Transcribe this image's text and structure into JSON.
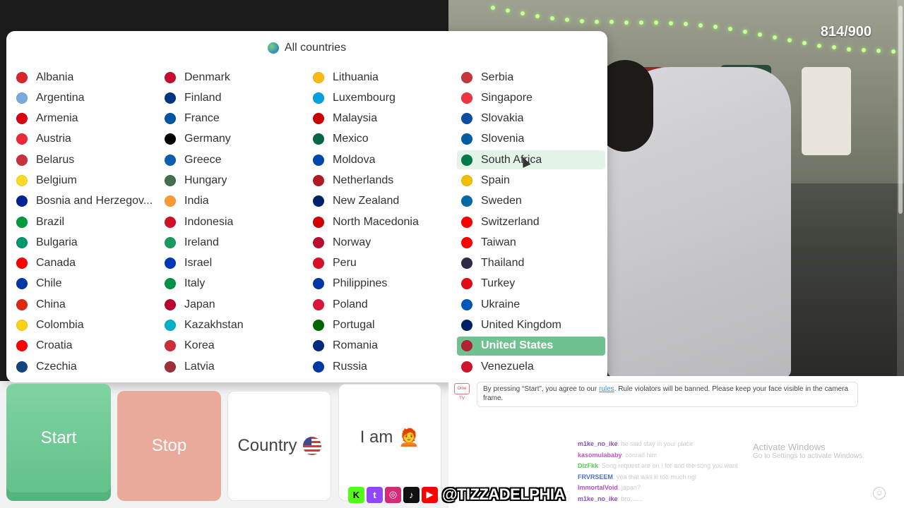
{
  "counter": "814/900",
  "popup": {
    "title": "All countries",
    "countries": [
      {
        "name": "Albania",
        "flag": "#d9252b"
      },
      {
        "name": "Argentina",
        "flag": "#74acdf"
      },
      {
        "name": "Armenia",
        "flag": "#d90012"
      },
      {
        "name": "Austria",
        "flag": "#ed2939"
      },
      {
        "name": "Belarus",
        "flag": "#c8313e"
      },
      {
        "name": "Belgium",
        "flag": "#fdda24"
      },
      {
        "name": "Bosnia and Herzegov...",
        "flag": "#002395"
      },
      {
        "name": "Brazil",
        "flag": "#009c3b"
      },
      {
        "name": "Bulgaria",
        "flag": "#00966e"
      },
      {
        "name": "Canada",
        "flag": "#ff0000"
      },
      {
        "name": "Chile",
        "flag": "#0039a6"
      },
      {
        "name": "China",
        "flag": "#de2910"
      },
      {
        "name": "Colombia",
        "flag": "#fcd116"
      },
      {
        "name": "Croatia",
        "flag": "#ff0000"
      },
      {
        "name": "Czechia",
        "flag": "#11457e"
      },
      {
        "name": "Denmark",
        "flag": "#c60c30"
      },
      {
        "name": "Finland",
        "flag": "#003580"
      },
      {
        "name": "France",
        "flag": "#0055a4"
      },
      {
        "name": "Germany",
        "flag": "#000000"
      },
      {
        "name": "Greece",
        "flag": "#0d5eaf"
      },
      {
        "name": "Hungary",
        "flag": "#436f4d"
      },
      {
        "name": "India",
        "flag": "#ff9933"
      },
      {
        "name": "Indonesia",
        "flag": "#ce1126"
      },
      {
        "name": "Ireland",
        "flag": "#169b62"
      },
      {
        "name": "Israel",
        "flag": "#0038b8"
      },
      {
        "name": "Italy",
        "flag": "#009246"
      },
      {
        "name": "Japan",
        "flag": "#bc002d"
      },
      {
        "name": "Kazakhstan",
        "flag": "#00afca"
      },
      {
        "name": "Korea",
        "flag": "#cd2e3a"
      },
      {
        "name": "Latvia",
        "flag": "#9e3039"
      },
      {
        "name": "Lithuania",
        "flag": "#fdb913"
      },
      {
        "name": "Luxembourg",
        "flag": "#00a1de"
      },
      {
        "name": "Malaysia",
        "flag": "#cc0001"
      },
      {
        "name": "Mexico",
        "flag": "#006847"
      },
      {
        "name": "Moldova",
        "flag": "#0046ae"
      },
      {
        "name": "Netherlands",
        "flag": "#ae1c28"
      },
      {
        "name": "New Zealand",
        "flag": "#012169"
      },
      {
        "name": "North Macedonia",
        "flag": "#d20000"
      },
      {
        "name": "Norway",
        "flag": "#ba0c2f"
      },
      {
        "name": "Peru",
        "flag": "#d91023"
      },
      {
        "name": "Philippines",
        "flag": "#0038a8"
      },
      {
        "name": "Poland",
        "flag": "#dc143c"
      },
      {
        "name": "Portugal",
        "flag": "#006600"
      },
      {
        "name": "Romania",
        "flag": "#002b7f"
      },
      {
        "name": "Russia",
        "flag": "#0039a6"
      },
      {
        "name": "Serbia",
        "flag": "#c6363c"
      },
      {
        "name": "Singapore",
        "flag": "#ef3340"
      },
      {
        "name": "Slovakia",
        "flag": "#0b4ea2"
      },
      {
        "name": "Slovenia",
        "flag": "#005da4"
      },
      {
        "name": "South Africa",
        "flag": "#007a4d"
      },
      {
        "name": "Spain",
        "flag": "#f1bf00"
      },
      {
        "name": "Sweden",
        "flag": "#006aa7"
      },
      {
        "name": "Switzerland",
        "flag": "#ff0000"
      },
      {
        "name": "Taiwan",
        "flag": "#fe0000"
      },
      {
        "name": "Thailand",
        "flag": "#2d2a4a"
      },
      {
        "name": "Turkey",
        "flag": "#e30a17"
      },
      {
        "name": "Ukraine",
        "flag": "#0057b7"
      },
      {
        "name": "United Kingdom",
        "flag": "#012169"
      },
      {
        "name": "United States",
        "flag": "#b22234"
      },
      {
        "name": "Venezuela",
        "flag": "#cf142b"
      }
    ],
    "hovered": "South Africa",
    "selected": "United States"
  },
  "controls": {
    "start": "Start",
    "stop": "Stop",
    "country": "Country",
    "iam": "I am",
    "iam_avatar": "🧑‍🦰"
  },
  "chat": {
    "logo": "Ome TV",
    "notice_before": "By pressing “Start”, you agree to our ",
    "notice_link": "rules",
    "notice_after": ". Rule violators will be banned. Please keep your face visible in the camera frame.",
    "messages": [
      {
        "user": "m1ke_no_ike",
        "text": ": he said stay in your place",
        "color": "#8a4fd1"
      },
      {
        "user": "kasomulababy",
        "text": ": conrad him",
        "color": "#c94fd6"
      },
      {
        "user": "DizFkk",
        "text": ": Song request are on ! for and the song you want",
        "color": "#4fd14f"
      },
      {
        "user": "FRVRSEEM",
        "text": ": yea that was lil too much ngl",
        "color": "#4f6fd1"
      },
      {
        "user": "ImmortalVoid",
        "text": ": japan?",
        "color": "#b04fd1"
      },
      {
        "user": "m1ke_no_ike",
        "text": ": bro.......",
        "color": "#8a4fd1"
      }
    ]
  },
  "activate": {
    "title": "Activate Windows",
    "subtitle": "Go to Settings to activate Windows."
  },
  "social": {
    "handle": "@TIZZADELPHIA",
    "icons": [
      {
        "name": "kick-icon",
        "glyph": "K",
        "color": "#53fc18"
      },
      {
        "name": "twitch-icon",
        "glyph": "t",
        "color": "#9146ff"
      },
      {
        "name": "instagram-icon",
        "glyph": "◎",
        "color": "#d62976"
      },
      {
        "name": "tiktok-icon",
        "glyph": "♪",
        "color": "#111111"
      },
      {
        "name": "youtube-icon",
        "glyph": "▶",
        "color": "#ff0000"
      }
    ]
  }
}
